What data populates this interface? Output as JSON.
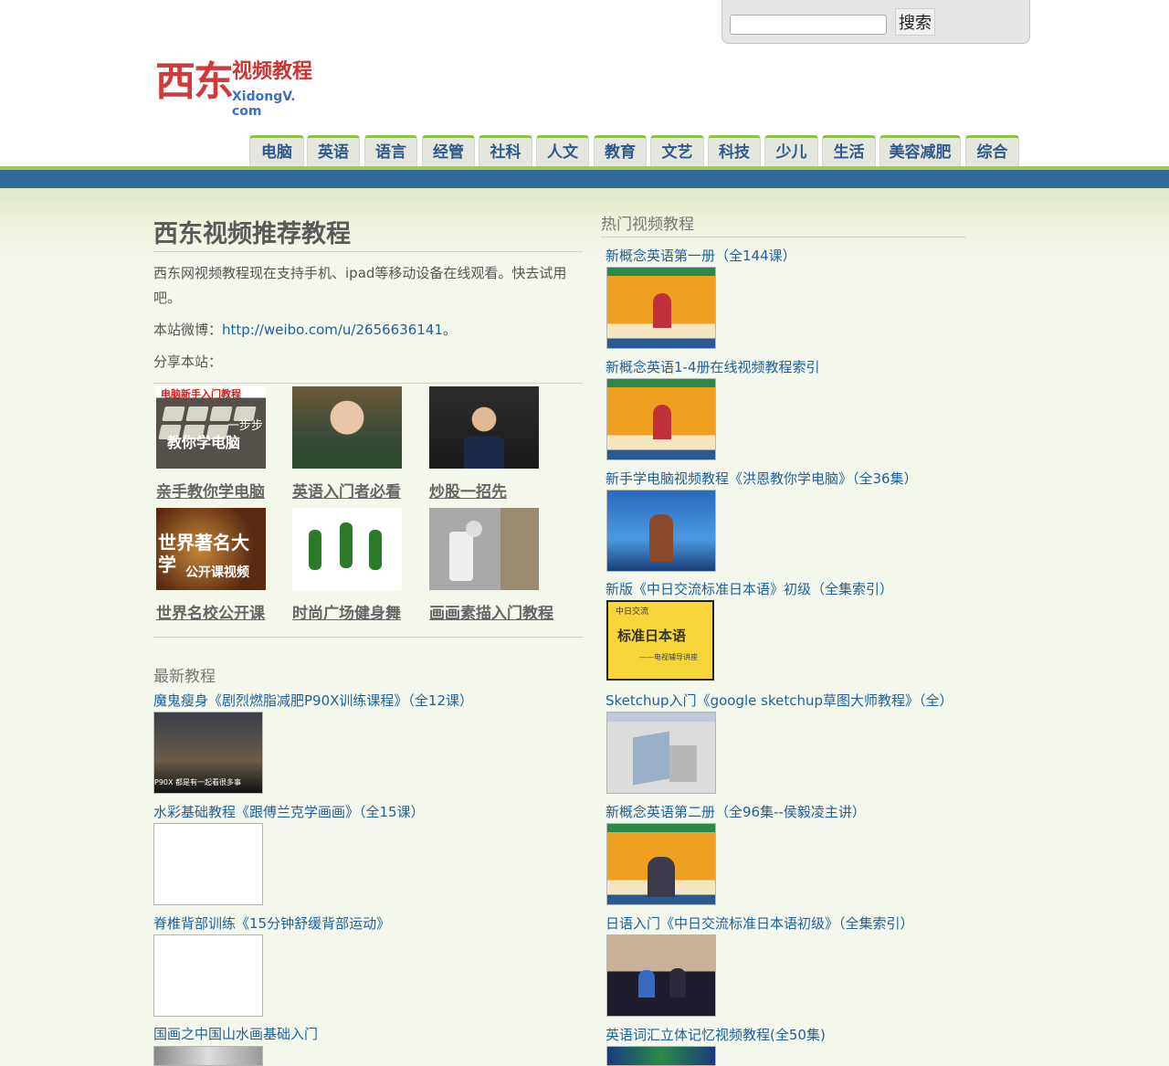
{
  "search": {
    "placeholder": "",
    "value": "",
    "button_label": "搜索"
  },
  "logo": {
    "main": "西东",
    "sub": "视频教程",
    "url": "XidongV. com"
  },
  "nav": {
    "tabs": [
      {
        "label": "电脑"
      },
      {
        "label": "英语"
      },
      {
        "label": "语言"
      },
      {
        "label": "经管"
      },
      {
        "label": "社科"
      },
      {
        "label": "人文"
      },
      {
        "label": "教育"
      },
      {
        "label": "文艺"
      },
      {
        "label": "科技"
      },
      {
        "label": "少儿"
      },
      {
        "label": "生活"
      },
      {
        "label": "美容减肥"
      },
      {
        "label": "综合"
      }
    ]
  },
  "intro": {
    "title": "西东视频推荐教程",
    "text": "西东网视频教程现在支持手机、ipad等移动设备在线观看。快去试用吧。",
    "weibo_prefix": "本站微博：",
    "weibo_link": "http://weibo.com/u/2656636141",
    "weibo_suffix": "。",
    "share_label": "分享本站："
  },
  "recommended": [
    {
      "title": "亲手教你学电脑",
      "thumb": "keyboard-thumbnail",
      "thumb_text_top": "电脑新手入门教程",
      "thumb_text_mid": "一步步",
      "thumb_text_bottom": "教你学电脑"
    },
    {
      "title": "英语入门者必看",
      "thumb": "old-man-thumbnail"
    },
    {
      "title": "炒股一招先",
      "thumb": "lecturer-thumbnail"
    },
    {
      "title": "世界名校公开课",
      "thumb": "university-thumbnail",
      "thumb_text_top": "世界著名大学",
      "thumb_text_bottom": "公开课视频"
    },
    {
      "title": "时尚广场健身舞",
      "thumb": "dancers-thumbnail"
    },
    {
      "title": "画画素描入门教程",
      "thumb": "sketch-thumbnail"
    }
  ],
  "latest": {
    "heading": "最新教程",
    "items": [
      {
        "title": "魔鬼瘦身《剧烈燃脂减肥P90X训练课程》（全12课）",
        "thumb": "p90x-thumbnail",
        "thumb_caption": "P90X 都是有一起看很多事"
      },
      {
        "title": "水彩基础教程《跟傅兰克学画画》（全15课）",
        "thumb": "blank-thumbnail"
      },
      {
        "title": "脊椎背部训练《15分钟舒缓背部运动》",
        "thumb": "blank-thumbnail"
      },
      {
        "title": "国画之中国山水画基础入门",
        "thumb": "painting-thumbnail"
      }
    ]
  },
  "popular": {
    "heading": "热门视频教程",
    "items": [
      {
        "title": "新概念英语第一册（全144课）",
        "thumb": "new-concept-english-thumbnail"
      },
      {
        "title": "新概念英语1-4册在线视频教程索引",
        "thumb": "new-concept-english-thumbnail"
      },
      {
        "title": "新手学电脑视频教程《洪恩教你学电脑》（全36集）",
        "thumb": "computer-lesson-thumbnail"
      },
      {
        "title": "新版《中日交流标准日本语》初级（全集索引）",
        "thumb": "japanese-textbook-thumbnail",
        "thumb_text_top": "中日交流",
        "thumb_text_mid": "标准日本语",
        "thumb_text_bottom": "——电视辅导讲座"
      },
      {
        "title": "Sketchup入门《google sketchup草图大师教程》（全）",
        "thumb": "sketchup-thumbnail"
      },
      {
        "title": "新概念英语第二册（全96集--侯毅凌主讲）",
        "thumb": "new-concept-english-thumbnail"
      },
      {
        "title": "日语入门《中日交流标准日本语初级》（全集索引）",
        "thumb": "japanese-studio-thumbnail"
      },
      {
        "title": "英语词汇立体记忆视频教程(全50集)",
        "thumb": "vocabulary-thumbnail"
      }
    ]
  },
  "colors": {
    "nav_bar": "#2f6b9b",
    "nav_accent": "#a8c45a",
    "link": "#1f5f9a",
    "logo_red": "#d13a3a",
    "background": "#f4f7ec"
  }
}
